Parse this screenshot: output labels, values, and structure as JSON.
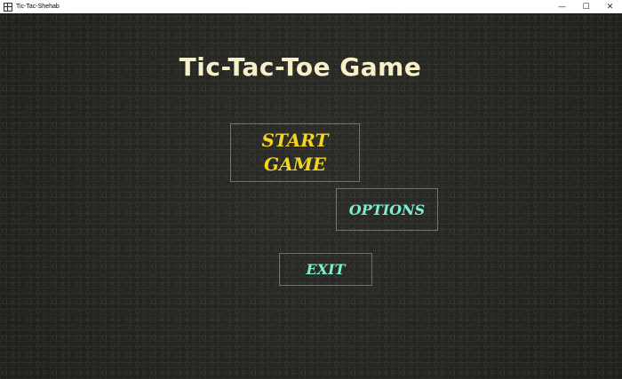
{
  "window": {
    "title": "Tic-Tac-Shehab",
    "minimize_glyph": "—",
    "maximize_glyph": "☐",
    "close_glyph": "✕"
  },
  "game": {
    "title": "Tic-Tac-Toe Game",
    "menu": {
      "start_line1": "START",
      "start_line2": "GAME",
      "options": "OPTIONS",
      "exit": "EXIT"
    }
  },
  "colors": {
    "background": "#23231f",
    "title": "#f7efc9",
    "start": "#f2d51c",
    "secondary": "#7ef0d0"
  }
}
